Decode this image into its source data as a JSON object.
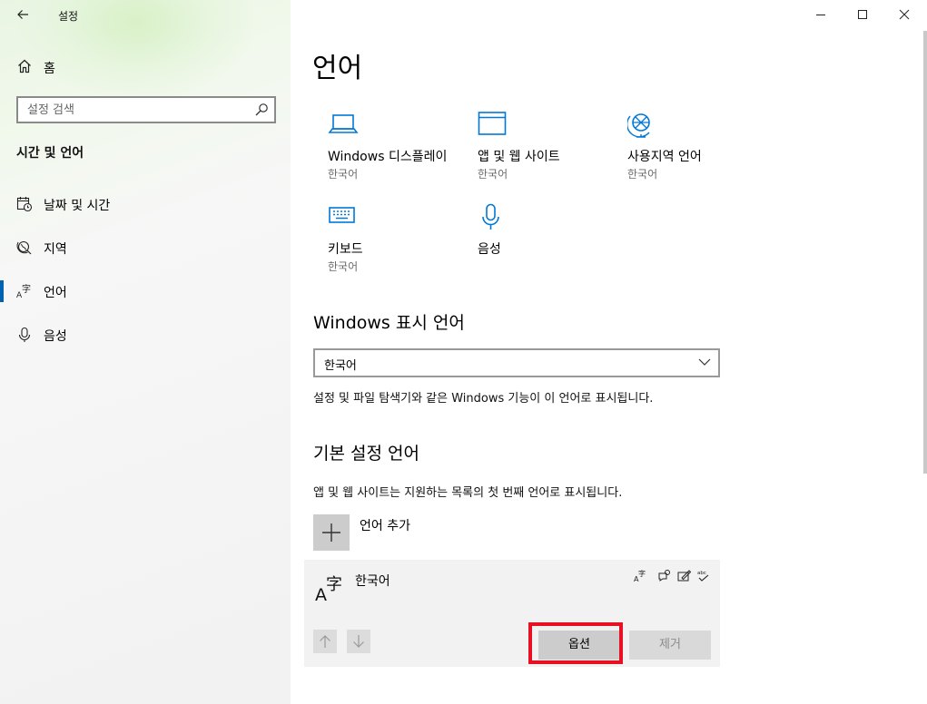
{
  "app": {
    "title": "설정"
  },
  "sidebar": {
    "home_label": "홈",
    "search_placeholder": "설정 검색",
    "section_title": "시간 및 언어",
    "items": [
      {
        "label": "날짜 및 시간",
        "icon": "calendar-clock-icon",
        "active": false
      },
      {
        "label": "지역",
        "icon": "globe-region-icon",
        "active": false
      },
      {
        "label": "언어",
        "icon": "language-icon",
        "active": true
      },
      {
        "label": "음성",
        "icon": "microphone-icon",
        "active": false
      }
    ]
  },
  "main": {
    "title": "언어",
    "tiles": [
      {
        "name": "Windows 디스플레이",
        "sub": "한국어",
        "icon": "laptop-icon"
      },
      {
        "name": "앱 및 웹 사이트",
        "sub": "한국어",
        "icon": "window-icon"
      },
      {
        "name": "사용지역 언어",
        "sub": "한국어",
        "icon": "globe-language-icon"
      },
      {
        "name": "키보드",
        "sub": "한국어",
        "icon": "keyboard-icon"
      },
      {
        "name": "음성",
        "sub": "",
        "icon": "microphone-icon"
      }
    ],
    "display_language": {
      "heading": "Windows 표시 언어",
      "selected": "한국어",
      "description": "설정 및 파일 탐색기와 같은 Windows 기능이 이 언어로 표시됩니다."
    },
    "preferred": {
      "heading": "기본 설정 언어",
      "description": "앱 및 웹 사이트는 지원하는 목록의 첫 번째 언어로 표시됩니다.",
      "add_label": "언어 추가",
      "language": {
        "name": "한국어",
        "features": [
          "display-language-icon",
          "speech-icon",
          "handwriting-icon",
          "spellcheck-icon"
        ],
        "options_label": "옵션",
        "remove_label": "제거"
      }
    }
  },
  "colors": {
    "accent": "#0063b1",
    "highlight": "#e81123",
    "icon_blue": "#0078d7"
  }
}
